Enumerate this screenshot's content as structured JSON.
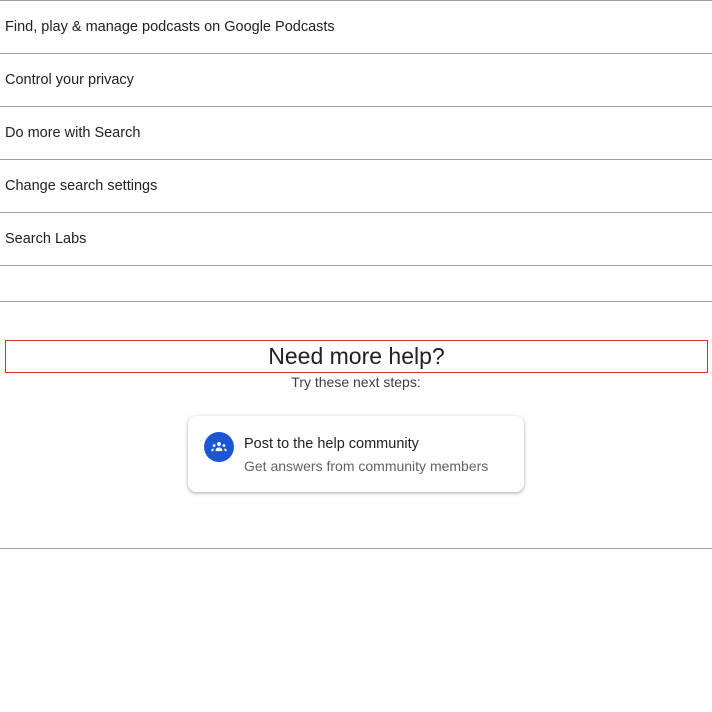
{
  "topics": [
    {
      "label": "Find, play & manage podcasts on Google Podcasts"
    },
    {
      "label": "Control your privacy"
    },
    {
      "label": "Do more with Search"
    },
    {
      "label": "Change search settings"
    },
    {
      "label": "Search Labs"
    }
  ],
  "help": {
    "title": "Need more help?",
    "subtitle": "Try these next steps:",
    "card": {
      "icon": "community-icon",
      "title": "Post to the help community",
      "subtitle": "Get answers from community members"
    }
  },
  "colors": {
    "accent": "#1a56d6",
    "highlight_border": "#d93025",
    "divider": "#9e9e9e"
  }
}
